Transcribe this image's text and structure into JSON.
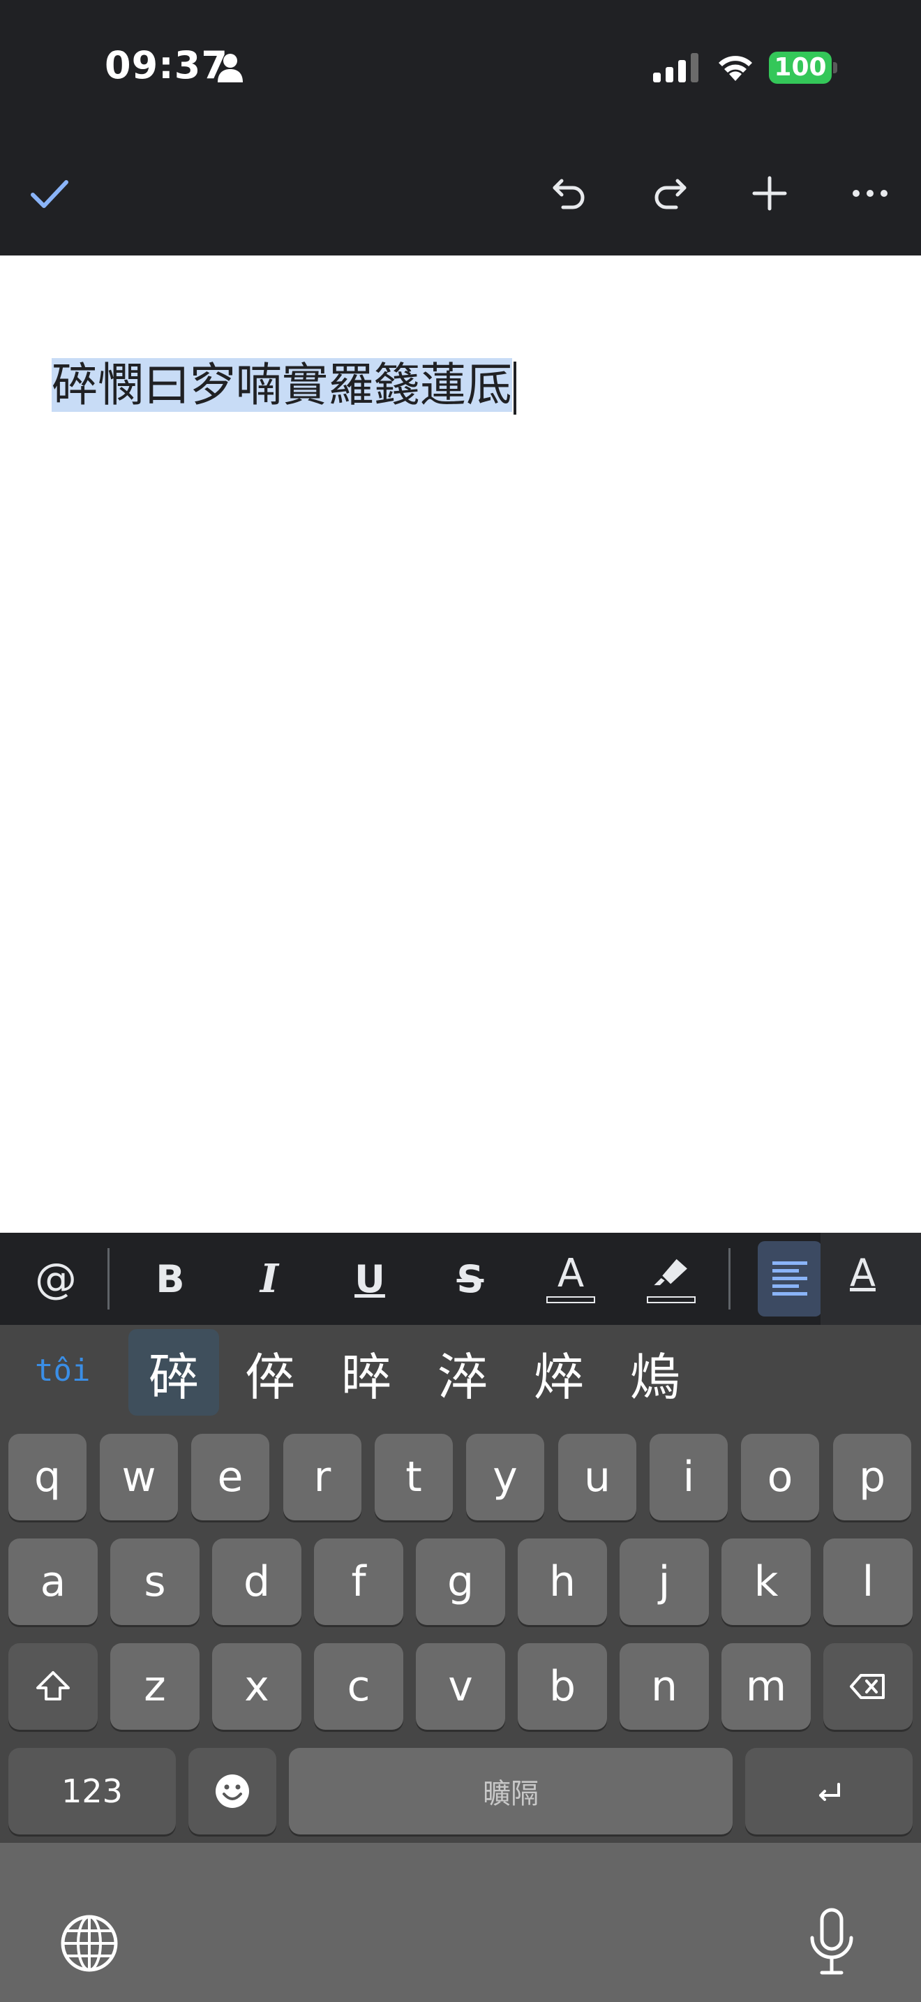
{
  "status_bar": {
    "time": "09:37",
    "battery": "100",
    "battery_color": "#34c759",
    "icons": [
      "person-icon",
      "signal-icon",
      "wifi-icon",
      "battery-icon"
    ]
  },
  "toolbar": {
    "done_icon": "checkmark-icon",
    "undo_icon": "undo-icon",
    "redo_icon": "redo-icon",
    "insert_icon": "plus-icon",
    "more_icon": "more-icon"
  },
  "document": {
    "selected_text": "碎憫曰穸喃實羅籛蓮厎"
  },
  "format_bar": {
    "mention": "@",
    "bold": "B",
    "italic": "I",
    "underline": "U",
    "strikethrough": "S",
    "text_color": "A",
    "text_style": "A",
    "accent": "#8ab4f8"
  },
  "keyboard": {
    "composition": "tôi",
    "candidates": [
      "碎",
      "倅",
      "晬",
      "淬",
      "焠",
      "熓"
    ],
    "row1": [
      "q",
      "w",
      "e",
      "r",
      "t",
      "y",
      "u",
      "i",
      "o",
      "p"
    ],
    "row2": [
      "a",
      "s",
      "d",
      "f",
      "g",
      "h",
      "j",
      "k",
      "l"
    ],
    "row3": [
      "z",
      "x",
      "c",
      "v",
      "b",
      "n",
      "m"
    ],
    "numbers_key": "123",
    "space_label": "曠隔"
  }
}
